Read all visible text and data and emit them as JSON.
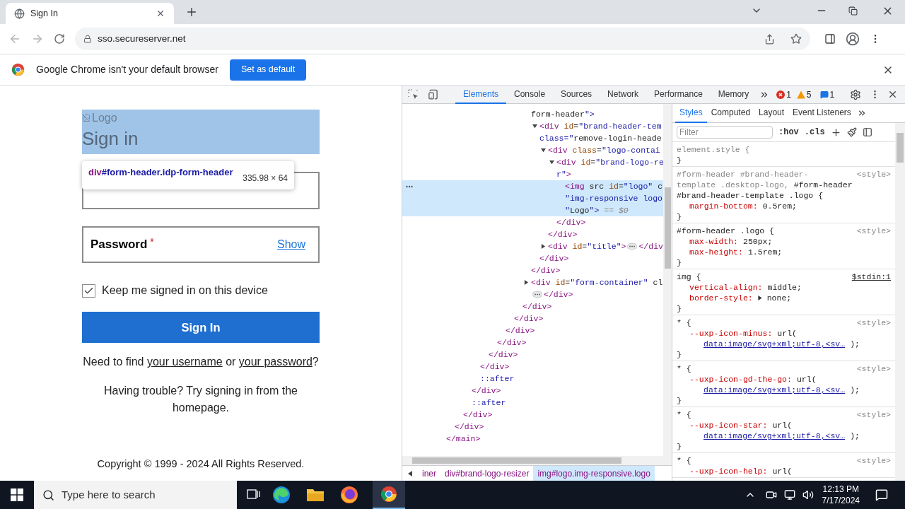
{
  "browser": {
    "tab": {
      "title": "Sign In"
    },
    "address": "sso.secureserver.net",
    "infobar": {
      "message": "Google Chrome isn't your default browser",
      "button": "Set as default"
    }
  },
  "page": {
    "logo_alt": "Logo",
    "heading": "Sign in",
    "inspector_tooltip": {
      "tag": "div",
      "selector": "#form-header.idp-form-header",
      "size": "335.98 × 64"
    },
    "password": {
      "label": "Password",
      "required_mark": "*",
      "toggle": "Show"
    },
    "remember": {
      "label": "Keep me signed in on this device",
      "checked": true
    },
    "submit": "Sign In",
    "help": [
      {
        "kind": "text",
        "text": "Need to find "
      },
      {
        "kind": "link",
        "text": "your username"
      },
      {
        "kind": "text",
        "text": " or "
      },
      {
        "kind": "link",
        "text": "your password"
      },
      {
        "kind": "text",
        "text": "?"
      }
    ],
    "trouble": "Having trouble? Try signing in from the homepage.",
    "copyright": "Copyright © 1999 - 2024 All Rights Reserved."
  },
  "devtools": {
    "tabs": [
      {
        "label": "Elements",
        "selected": true
      },
      {
        "label": "Console",
        "selected": false
      },
      {
        "label": "Sources",
        "selected": false
      },
      {
        "label": "Network",
        "selected": false
      },
      {
        "label": "Performance",
        "selected": false
      },
      {
        "label": "Memory",
        "selected": false
      }
    ],
    "errors": "1",
    "warnings": "5",
    "messages": "1",
    "dom": [
      {
        "kind": "element",
        "close": "</main>",
        "children": [
          {
            "kind": "element",
            "close": "</div>",
            "children": [
              {
                "kind": "element",
                "close": "</div>",
                "children": [
                  {
                    "kind": "element",
                    "close": "</div>",
                    "children": [
                      {
                        "kind": "element",
                        "close": "</div>",
                        "children": [
                          {
                            "kind": "element",
                            "close": "</div>",
                            "children": [
                              {
                                "kind": "element",
                                "close": "</div>",
                                "children": [
                                  {
                                    "kind": "element",
                                    "close": "</div>",
                                    "children": [
                                      {
                                        "kind": "element",
                                        "close": "</div>",
                                        "children": [
                                          {
                                            "kind": "element",
                                            "close": "</div>",
                                            "children": [
                                              {
                                                "kind": "element",
                                                "selected": false,
                                                "lines": [
                                                  "form-header\">"
                                                ],
                                                "close": "</div>",
                                                "children": [
                                                  {
                                                    "kind": "element",
                                                    "selected": false,
                                                    "expanded": true,
                                                    "lines": [
                                                      "<div id=\"brand-header-tem",
                                                      "class=\"remove-login-heade"
                                                    ],
                                                    "close": "</div>",
                                                    "children": [
                                                      {
                                                        "kind": "element",
                                                        "selected": false,
                                                        "expanded": true,
                                                        "lines": [
                                                          "<div class=\"logo-contai"
                                                        ],
                                                        "close": "</div>",
                                                        "children": [
                                                          {
                                                            "kind": "element",
                                                            "selected": false,
                                                            "expanded": true,
                                                            "lines": [
                                                              "<div id=\"brand-logo-re",
                                                              "r\">"
                                                            ],
                                                            "close": "</div>",
                                                            "children": [
                                                              {
                                                                "kind": "element",
                                                                "selected": true,
                                                                "lines": [
                                                                  "<img src id=\"logo\" c",
                                                                  "\"img-responsive logo",
                                                                  "\"Logo\">"
                                                                ],
                                                                "marker": "== $0"
                                                              }
                                                            ]
                                                          }
                                                        ]
                                                      },
                                                      {
                                                        "kind": "element",
                                                        "selected": false,
                                                        "expanded": false,
                                                        "lines": [
                                                          "<div id=\"title\">"
                                                        ],
                                                        "close": "</div"
                                                      }
                                                    ]
                                                  }
                                                ]
                                              },
                                              {
                                                "kind": "element",
                                                "selected": false,
                                                "expanded": false,
                                                "wrap_close": true,
                                                "lines": [
                                                  "<div id=\"form-container\" cl"
                                                ],
                                                "close": "</div>"
                                              }
                                            ]
                                          }
                                        ]
                                      }
                                    ]
                                  }
                                ]
                              }
                            ]
                          }
                        ]
                      },
                      {
                        "kind": "pseudo",
                        "lines": [
                          "::after"
                        ]
                      }
                    ]
                  },
                  {
                    "kind": "pseudo",
                    "lines": [
                      "::after"
                    ]
                  }
                ]
              }
            ]
          }
        ]
      }
    ],
    "breadcrumbs": [
      {
        "label": "iner",
        "selected": false
      },
      {
        "label": "div#brand-logo-resizer",
        "selected": false
      },
      {
        "label": "img#logo.img-responsive.logo",
        "selected": true
      }
    ],
    "sidebar_tabs": [
      {
        "label": "Styles",
        "selected": true
      },
      {
        "label": "Computed",
        "selected": false
      },
      {
        "label": "Layout",
        "selected": false
      },
      {
        "label": "Event Listeners",
        "selected": false
      }
    ],
    "filter": {
      "placeholder": "Filter"
    },
    "hov": ":hov",
    "cls": ".cls",
    "rules": [
      {
        "selector": [
          {
            "text": "element.style {",
            "matched": false
          }
        ],
        "close": "}"
      },
      {
        "selector": [
          {
            "text": "#form-header #brand-header-",
            "matched": false
          },
          {
            "text": "template .desktop-logo,",
            "matched": false
          },
          {
            "text": "#form-header",
            "matched": true
          },
          {
            "text": "#brand-header-template .logo {",
            "matched": true
          }
        ],
        "source": "<style>",
        "declarations": [
          {
            "property": "margin-bottom:",
            "value": "0.5rem;",
            "expandable": false
          }
        ],
        "close": "}"
      },
      {
        "selector": [
          {
            "text": "#form-header .logo {",
            "matched": true
          }
        ],
        "source": "<style>",
        "declarations": [
          {
            "property": "max-width:",
            "value": "250px;",
            "expandable": false
          },
          {
            "property": "max-height:",
            "value": "1.5rem;",
            "expandable": false
          }
        ],
        "close": "}"
      },
      {
        "selector": [
          {
            "text": "img {",
            "matched": true
          }
        ],
        "source": "$stdin:1",
        "source_link": true,
        "declarations": [
          {
            "property": "vertical-align:",
            "value": "middle;",
            "expandable": false
          },
          {
            "property": "border-style:",
            "value": "none;",
            "expandable": true
          }
        ],
        "close": "}"
      },
      {
        "selector": [
          {
            "text": "* {",
            "matched": true
          }
        ],
        "source": "<style>",
        "declarations": [
          {
            "property": "--uxp-icon-minus:",
            "value": "url(",
            "link": "data:image/svg+xml;utf-8,<sv…",
            "tail": ");",
            "expandable": false
          }
        ],
        "close": "}"
      },
      {
        "selector": [
          {
            "text": "* {",
            "matched": true
          }
        ],
        "source": "<style>",
        "declarations": [
          {
            "property": "--uxp-icon-gd-the-go:",
            "value": "url(",
            "link": "data:image/svg+xml;utf-8,<sv…",
            "tail": ");",
            "expandable": false
          }
        ],
        "close": "}"
      },
      {
        "selector": [
          {
            "text": "* {",
            "matched": true
          }
        ],
        "source": "<style>",
        "declarations": [
          {
            "property": "--uxp-icon-star:",
            "value": "url(",
            "link": "data:image/svg+xml;utf-8,<sv…",
            "tail": ");",
            "expandable": false
          }
        ],
        "close": "}"
      },
      {
        "selector": [
          {
            "text": "* {",
            "matched": true
          }
        ],
        "source": "<style>",
        "declarations": [
          {
            "property": "--uxp-icon-help:",
            "value": "url(",
            "expandable": false
          }
        ]
      }
    ]
  },
  "taskbar": {
    "search_placeholder": "Type here to search",
    "time": "12:13 PM",
    "date": "7/17/2024"
  }
}
